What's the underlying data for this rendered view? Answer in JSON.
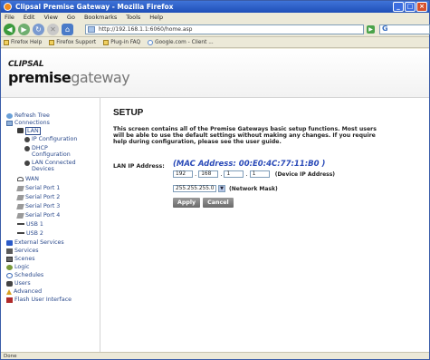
{
  "window": {
    "title": "Clipsal Premise Gateway - Mozilla Firefox"
  },
  "menu": [
    "File",
    "Edit",
    "View",
    "Go",
    "Bookmarks",
    "Tools",
    "Help"
  ],
  "nav": {
    "url": "http://192.168.1.1:6060/home.asp"
  },
  "bookmarks": [
    "Firefox Help",
    "Firefox Support",
    "Plug-in FAQ",
    "Google.com - Client ..."
  ],
  "logo": {
    "brand": "CLIPSAL",
    "product_bold": "premise",
    "product_light": "gateway"
  },
  "sidebar": {
    "items": [
      {
        "label": "Refresh Tree"
      },
      {
        "label": "Connections"
      },
      {
        "label": "LAN"
      },
      {
        "label": "IP Configuration"
      },
      {
        "label": "DHCP Configuration"
      },
      {
        "label": "LAN Connected Devices"
      },
      {
        "label": "WAN"
      },
      {
        "label": "Serial Port 1"
      },
      {
        "label": "Serial Port 2"
      },
      {
        "label": "Serial Port 3"
      },
      {
        "label": "Serial Port 4"
      },
      {
        "label": "USB 1"
      },
      {
        "label": "USB 2"
      },
      {
        "label": "External Services"
      },
      {
        "label": "Services"
      },
      {
        "label": "Scenes"
      },
      {
        "label": "Logic"
      },
      {
        "label": "Schedules"
      },
      {
        "label": "Users"
      },
      {
        "label": "Advanced"
      },
      {
        "label": "Flash User Interface"
      }
    ]
  },
  "setup": {
    "title": "SETUP",
    "description": "This screen contains all of the Premise Gateways basic setup functions. Most users will be able to use the default settings without making any changes. If you require help during configuration, please see the user guide.",
    "lan_label": "LAN IP Address:",
    "mac": "(MAC Address: 00:E0:4C:77:11:B0 )",
    "ip": [
      "192",
      "168",
      "1",
      "1"
    ],
    "ip_note": "(Device IP Address)",
    "mask": "255.255.255.0",
    "mask_note": "(Network Mask)",
    "apply": "Apply",
    "cancel": "Cancel"
  },
  "status": "Done"
}
